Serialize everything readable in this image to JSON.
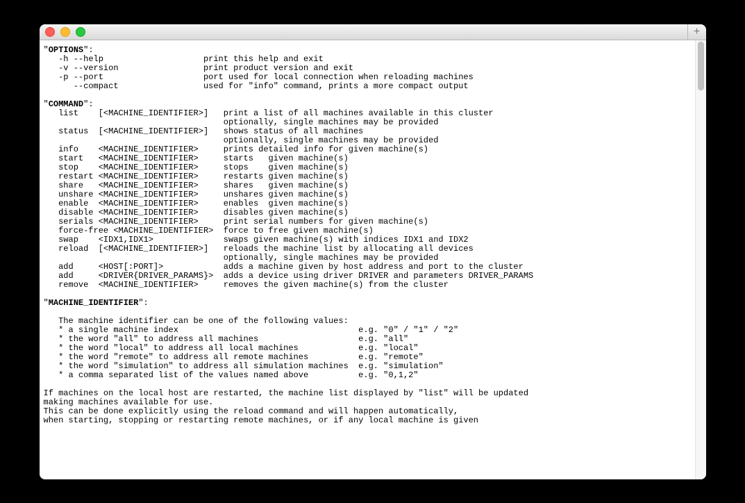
{
  "titlebar": {
    "close": "",
    "min": "",
    "max": "",
    "plus": "+"
  },
  "sections": {
    "options_heading": "OPTIONS",
    "options": [
      {
        "flag": "-h --help",
        "pad": "                    ",
        "desc": "print this help and exit"
      },
      {
        "flag": "-v --version",
        "pad": "                 ",
        "desc": "print product version and exit"
      },
      {
        "flag": "-p --port",
        "pad": "                    ",
        "desc": "port used for local connection when reloading machines"
      },
      {
        "flag": "   --compact",
        "pad": "                 ",
        "desc": "used for \"info\" command, prints a more compact output"
      }
    ],
    "command_heading": "COMMAND",
    "commands": [
      {
        "line": "   list    [<MACHINE_IDENTIFIER>]   print a list of all machines available in this cluster"
      },
      {
        "line": "                                    optionally, single machines may be provided"
      },
      {
        "line": "   status  [<MACHINE_IDENTIFIER>]   shows status of all machines"
      },
      {
        "line": "                                    optionally, single machines may be provided"
      },
      {
        "line": "   info    <MACHINE_IDENTIFIER>     prints detailed info for given machine(s)"
      },
      {
        "line": "   start   <MACHINE_IDENTIFIER>     starts   given machine(s)"
      },
      {
        "line": "   stop    <MACHINE_IDENTIFIER>     stops    given machine(s)"
      },
      {
        "line": "   restart <MACHINE_IDENTIFIER>     restarts given machine(s)"
      },
      {
        "line": "   share   <MACHINE_IDENTIFIER>     shares   given machine(s)"
      },
      {
        "line": "   unshare <MACHINE_IDENTIFIER>     unshares given machine(s)"
      },
      {
        "line": "   enable  <MACHINE_IDENTIFIER>     enables  given machine(s)"
      },
      {
        "line": "   disable <MACHINE_IDENTIFIER>     disables given machine(s)"
      },
      {
        "line": "   serials <MACHINE_IDENTIFIER>     print serial numbers for given machine(s)"
      },
      {
        "line": "   force-free <MACHINE_IDENTIFIER>  force to free given machine(s)"
      },
      {
        "line": "   swap    <IDX1,IDX1>              swaps given machine(s) with indices IDX1 and IDX2"
      },
      {
        "line": "   reload  [<MACHINE_IDENTIFIER>]   reloads the machine list by allocating all devices"
      },
      {
        "line": "                                    optionally, single machines may be provided"
      },
      {
        "line": "   add     <HOST[:PORT]>            adds a machine given by host address and port to the cluster"
      },
      {
        "line": "   add     <DRIVER{DRIVER_PARAMS}>  adds a device using driver DRIVER and parameters DRIVER_PARAMS"
      },
      {
        "line": "   remove  <MACHINE_IDENTIFIER>     removes the given machine(s) from the cluster"
      }
    ],
    "mid_heading": "MACHINE_IDENTIFIER",
    "mid_intro": "   The machine identifier can be one of the following values:",
    "mid": [
      {
        "line": "   * a single machine index                                    e.g. \"0\" / \"1\" / \"2\""
      },
      {
        "line": "   * the word \"all\" to address all machines                    e.g. \"all\""
      },
      {
        "line": "   * the word \"local\" to address all local machines            e.g. \"local\""
      },
      {
        "line": "   * the word \"remote\" to address all remote machines          e.g. \"remote\""
      },
      {
        "line": "   * the word \"simulation\" to address all simulation machines  e.g. \"simulation\""
      },
      {
        "line": "   * a comma separated list of the values named above          e.g. \"0,1,2\""
      }
    ],
    "footer": [
      "If machines on the local host are restarted, the machine list displayed by \"list\" will be updated",
      "making machines available for use.",
      "This can be done explicitly using the reload command and will happen automatically,",
      "when starting, stopping or restarting remote machines, or if any local machine is given"
    ]
  }
}
